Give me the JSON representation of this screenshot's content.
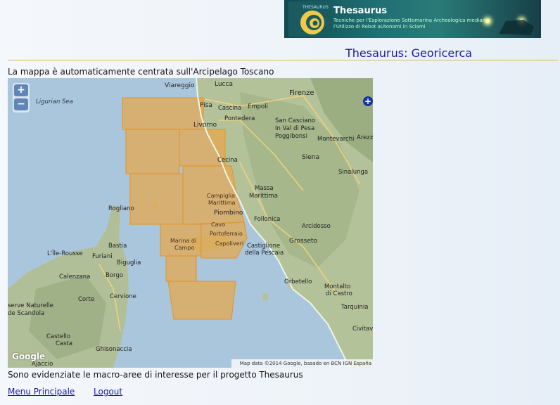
{
  "banner": {
    "title": "Thesaurus",
    "subtitle": "Tecniche per l'Esplorazione Sottomarina Archeologica mediante l'Utilizzo di Robot aUtonomi in Sciami",
    "logo_text": "THESAURUS",
    "icon": "nautilus-shell-logo"
  },
  "page": {
    "title": "Thesaurus: Georicerca",
    "intro": "La mappa è automaticamente centrata sull'Arcipelago Toscano",
    "caption": "Sono evidenziate le macro-aree di interesse per il progetto Thesaurus"
  },
  "map": {
    "zoom_in": "+",
    "zoom_out": "−",
    "fullscreen": "+",
    "google": "Google",
    "attribution": "Map data ©2014 Google, basado en BCN IGN España",
    "area_fill_color": "#e8a64a",
    "sea_color": "#aac6dd",
    "labels": {
      "ligurian_sea": "Ligurian Sea",
      "viareggio": "Viareggio",
      "lucca": "Lucca",
      "firenze": "Firenze",
      "pisa": "Pisa",
      "cascina": "Cascina",
      "empoli": "Empoli",
      "pontedera": "Pontedera",
      "livorno": "Livorno",
      "san_casciano": "San Casciano",
      "in_val_di_pesa": "In Val di Pesa",
      "poggibonsi": "Poggibonsi",
      "montevarchi": "Montevarchi",
      "arezzo": "Arezz",
      "cecina": "Cecina",
      "siena": "Siena",
      "sinalunga": "Sinalunga",
      "massa": "Massa",
      "marittima": "Marittima",
      "campiglia": "Campiglia",
      "campiglia_marittima": "Marittima",
      "piombino": "Piombino",
      "follonica": "Follonica",
      "arcidosso": "Arcidosso",
      "rogliano": "Rogliano",
      "cavo": "Cavo",
      "portoferraio": "Portoferraio",
      "marina_di": "Marina di",
      "campo": "Campo",
      "capoliveri": "Capoliveri",
      "castiglione": "Castiglione",
      "della_pescaia": "della Pescaia",
      "grosseto": "Grosseto",
      "bastia": "Bastia",
      "ile_rousse": "L'Île-Rousse",
      "furiani": "Furiani",
      "biguglia": "Biguglia",
      "calenzana": "Calenzana",
      "borgo": "Borgo",
      "corte": "Corte",
      "cervione": "Cervione",
      "riserve": "serve Naturelle",
      "de_scandola": "de Scandola",
      "orbetello": "Orbetello",
      "montalto": "Montalto",
      "di_castro": "di Castro",
      "tarquinia": "Tarquinia",
      "civitavecchia": "Civitavecch",
      "castello": "Castello",
      "ghisonaccia": "Ghisonaccia",
      "ajaccio": "Ajaccio",
      "casta": "Casta"
    }
  },
  "footer": {
    "menu": "Menu Principale",
    "logout": "Logout"
  }
}
